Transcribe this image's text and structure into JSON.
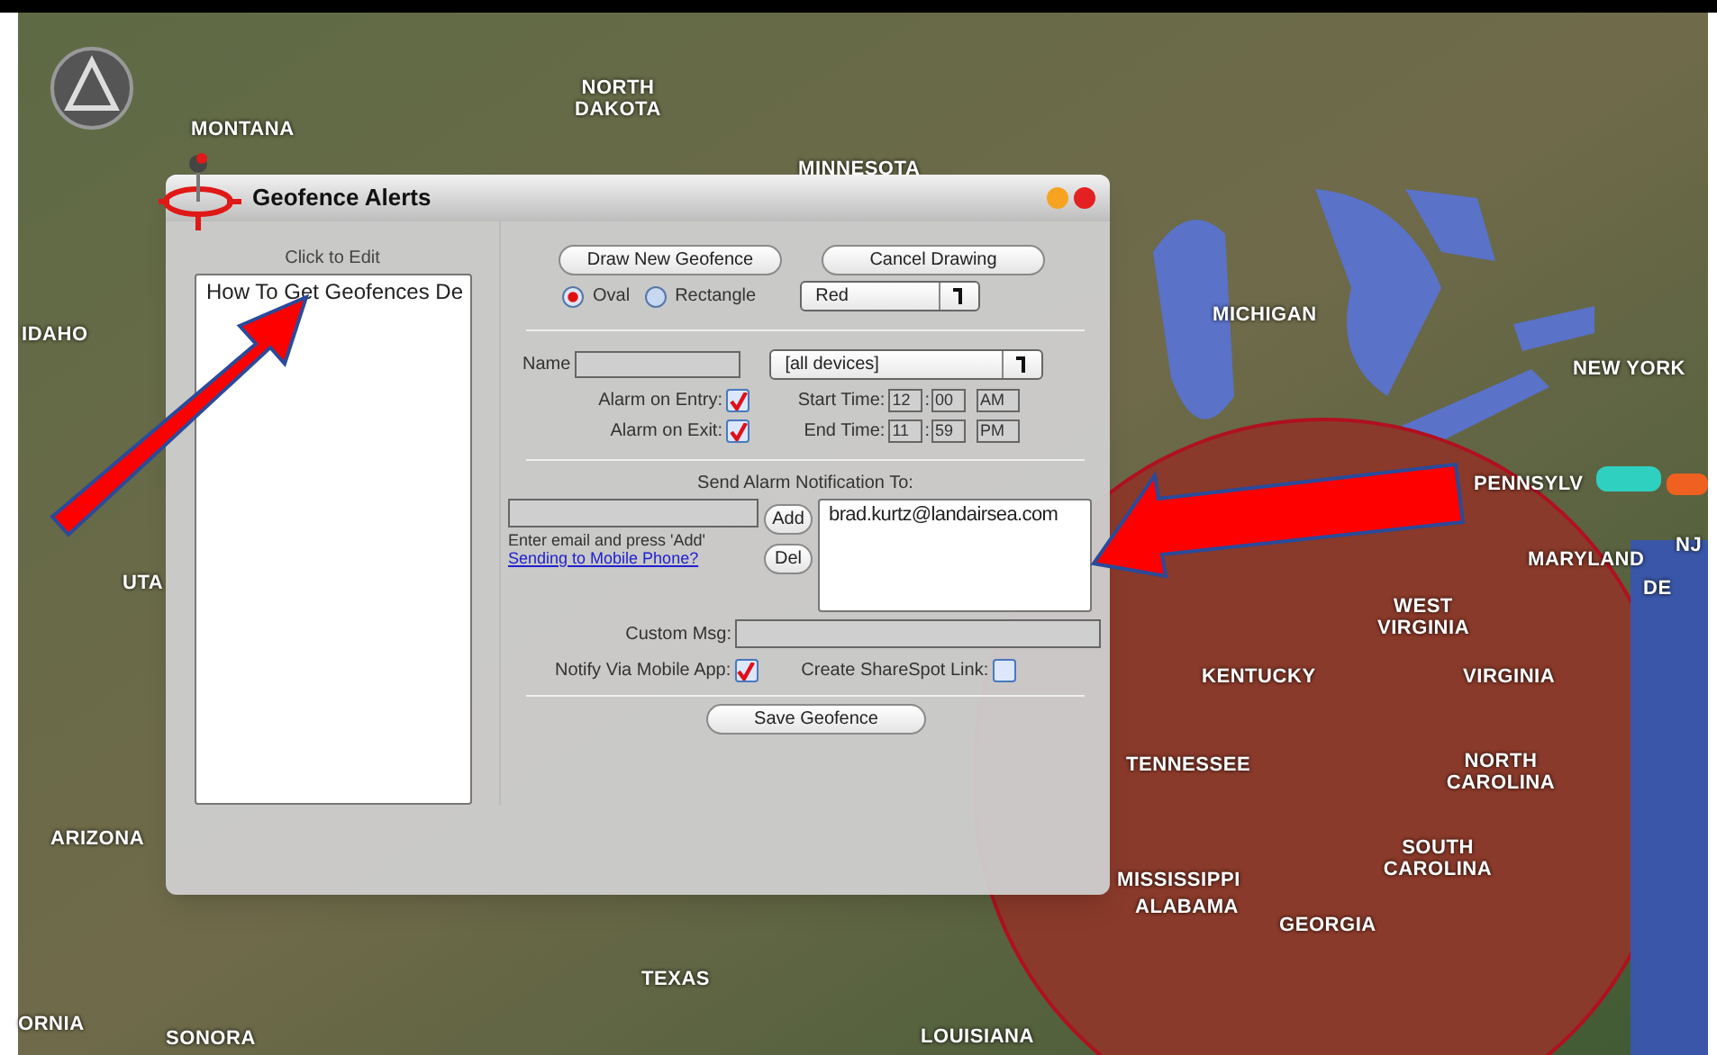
{
  "map": {
    "labels": [
      {
        "text": "NORTH DAKOTA"
      },
      {
        "text": "MONTANA"
      },
      {
        "text": "MINNESOTA"
      },
      {
        "text": "MICHIGAN"
      },
      {
        "text": "IDAHO"
      },
      {
        "text": "NEW YORK"
      },
      {
        "text": "PENNSYLV"
      },
      {
        "text": "NJ"
      },
      {
        "text": "MARYLAND"
      },
      {
        "text": "UTA"
      },
      {
        "text": "DE"
      },
      {
        "text": "WEST VIRGINIA"
      },
      {
        "text": "KENTUCKY"
      },
      {
        "text": "VIRGINIA"
      },
      {
        "text": "TENNESSEE"
      },
      {
        "text": "NORTH CAROLINA"
      },
      {
        "text": "ARIZONA"
      },
      {
        "text": "SOUTH CAROLINA"
      },
      {
        "text": "MISSISSIPPI"
      },
      {
        "text": "ALABAMA"
      },
      {
        "text": "GEORGIA"
      },
      {
        "text": "TEXAS"
      },
      {
        "text": "ORNIA"
      },
      {
        "text": "LOUISIANA"
      },
      {
        "text": "SONORA"
      }
    ]
  },
  "dialog": {
    "title": "Geofence Alerts",
    "list_caption": "Click to Edit",
    "geofences": [
      {
        "name": "How To Get Geofences De"
      }
    ],
    "draw_button": "Draw New Geofence",
    "cancel_button": "Cancel Drawing",
    "shapes": [
      {
        "label": "Oval",
        "selected": true
      },
      {
        "label": "Rectangle",
        "selected": false
      }
    ],
    "color_select": {
      "value": "Red"
    },
    "name_label": "Name",
    "device_select": {
      "value": "[all devices]"
    },
    "alarms": [
      {
        "label": "Alarm on Entry:",
        "checked": true
      },
      {
        "label": "Alarm on Exit:",
        "checked": true
      }
    ],
    "times": [
      {
        "label": "Start Time:",
        "hour": "12",
        "separator": ":",
        "minute": "00",
        "ampm": "AM"
      },
      {
        "label": "End Time:",
        "hour": "11",
        "separator": ":",
        "minute": "59",
        "ampm": "PM"
      }
    ],
    "notify_heading": "Send Alarm Notification To:",
    "email_hint": "Enter email and press 'Add'",
    "mobile_link": "Sending to Mobile Phone?",
    "add_button": "Add",
    "del_button": "Del",
    "recipients": [
      "brad.kurtz@landairsea.com"
    ],
    "custom_msg_label": "Custom Msg:",
    "options": [
      {
        "label": "Notify Via Mobile App:",
        "checked": true
      },
      {
        "label": "Create ShareSpot Link:",
        "checked": false
      }
    ],
    "save_button": "Save Geofence"
  }
}
